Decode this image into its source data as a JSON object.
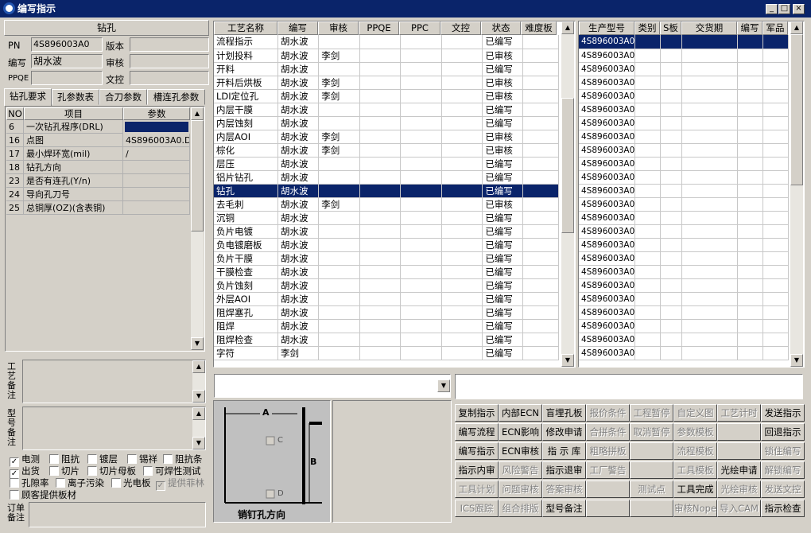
{
  "window": {
    "title": "编写指示",
    "min": "_",
    "max": "□",
    "close": "×"
  },
  "top": {
    "name": "钻孔",
    "pn_label": "PN",
    "pn_value": "4S896003A0",
    "version_label": "版本",
    "version_value": "",
    "author_label": "编写",
    "author_value": "胡水波",
    "review_label": "审核",
    "review_value": "",
    "ppqe_label": "PPQE",
    "ppqe_value": "",
    "control_label": "文控",
    "control_value": ""
  },
  "tabs": [
    "钻孔要求",
    "孔参数表",
    "合刀参数",
    "槽连孔参数"
  ],
  "param_table": {
    "headers": [
      "NO",
      "项目",
      "参数"
    ],
    "rows": [
      [
        "6",
        "一次钻孔程序(DRL)",
        ""
      ],
      [
        "16",
        "点图",
        "4S896003A0.D"
      ],
      [
        "17",
        "最小焊环宽(mil)",
        "/"
      ],
      [
        "18",
        "钻孔方向",
        ""
      ],
      [
        "23",
        "是否有连孔(Y/n)",
        ""
      ],
      [
        "24",
        "导向孔刀号",
        ""
      ],
      [
        "25",
        "总铜厚(OZ)(含表铜)",
        ""
      ]
    ]
  },
  "notes": {
    "process_note": "工艺备注",
    "model_note": "型号备注",
    "order_note": "订单备注"
  },
  "checkboxes": [
    {
      "label": "电测",
      "checked": true,
      "disabled": false
    },
    {
      "label": "阻抗",
      "checked": false,
      "disabled": false
    },
    {
      "label": "镀层",
      "checked": false,
      "disabled": false
    },
    {
      "label": "锡祥",
      "checked": false,
      "disabled": false
    },
    {
      "label": "阻抗条",
      "checked": false,
      "disabled": false
    },
    {
      "label": "出货",
      "checked": true,
      "disabled": false
    },
    {
      "label": "切片",
      "checked": false,
      "disabled": false
    },
    {
      "label": "切片母板",
      "checked": false,
      "disabled": false
    },
    {
      "label": "可焊性测试",
      "checked": false,
      "disabled": false
    },
    {
      "label": "孔隙率",
      "checked": false,
      "disabled": false
    },
    {
      "label": "离子污染",
      "checked": false,
      "disabled": false
    },
    {
      "label": "光电板",
      "checked": false,
      "disabled": false
    },
    {
      "label": "提供菲林",
      "checked": true,
      "disabled": true
    },
    {
      "label": "顾客提供板材",
      "checked": false,
      "disabled": false
    }
  ],
  "process_table": {
    "headers": [
      "工艺名称",
      "编写",
      "审核",
      "PPQE",
      "PPC",
      "文控",
      "状态",
      "难度板"
    ],
    "rows": [
      [
        "流程指示",
        "胡水波",
        "",
        "",
        "",
        "",
        "已编写",
        ""
      ],
      [
        "计划投料",
        "胡水波",
        "李剑",
        "",
        "",
        "",
        "已审核",
        ""
      ],
      [
        "开料",
        "胡水波",
        "",
        "",
        "",
        "",
        "已编写",
        ""
      ],
      [
        "开料后烘板",
        "胡水波",
        "李剑",
        "",
        "",
        "",
        "已审核",
        ""
      ],
      [
        "LDI定位孔",
        "胡水波",
        "李剑",
        "",
        "",
        "",
        "已审核",
        ""
      ],
      [
        "内层干膜",
        "胡水波",
        "",
        "",
        "",
        "",
        "已编写",
        ""
      ],
      [
        "内层蚀刻",
        "胡水波",
        "",
        "",
        "",
        "",
        "已编写",
        ""
      ],
      [
        "内层AOI",
        "胡水波",
        "李剑",
        "",
        "",
        "",
        "已审核",
        ""
      ],
      [
        "棕化",
        "胡水波",
        "李剑",
        "",
        "",
        "",
        "已审核",
        ""
      ],
      [
        "层压",
        "胡水波",
        "",
        "",
        "",
        "",
        "已编写",
        ""
      ],
      [
        "铝片钻孔",
        "胡水波",
        "",
        "",
        "",
        "",
        "已编写",
        ""
      ],
      [
        "钻孔",
        "胡水波",
        "",
        "",
        "",
        "",
        "已编写",
        ""
      ],
      [
        "去毛刺",
        "胡水波",
        "李剑",
        "",
        "",
        "",
        "已审核",
        ""
      ],
      [
        "沉铜",
        "胡水波",
        "",
        "",
        "",
        "",
        "已编写",
        ""
      ],
      [
        "负片电镀",
        "胡水波",
        "",
        "",
        "",
        "",
        "已编写",
        ""
      ],
      [
        "负电镀磨板",
        "胡水波",
        "",
        "",
        "",
        "",
        "已编写",
        ""
      ],
      [
        "负片干膜",
        "胡水波",
        "",
        "",
        "",
        "",
        "已编写",
        ""
      ],
      [
        "干膜检查",
        "胡水波",
        "",
        "",
        "",
        "",
        "已编写",
        ""
      ],
      [
        "负片蚀刻",
        "胡水波",
        "",
        "",
        "",
        "",
        "已编写",
        ""
      ],
      [
        "外层AOI",
        "胡水波",
        "",
        "",
        "",
        "",
        "已编写",
        ""
      ],
      [
        "阻焊塞孔",
        "胡水波",
        "",
        "",
        "",
        "",
        "已编写",
        ""
      ],
      [
        "阻焊",
        "胡水波",
        "",
        "",
        "",
        "",
        "已编写",
        ""
      ],
      [
        "阻焊检查",
        "胡水波",
        "",
        "",
        "",
        "",
        "已编写",
        ""
      ],
      [
        "字符",
        "李剑",
        "",
        "",
        "",
        "",
        "已编写",
        ""
      ]
    ],
    "selected": 11
  },
  "model_table": {
    "headers": [
      "生产型号",
      "类别",
      "S板",
      "交货期",
      "编写",
      "军品"
    ],
    "value": "4S896003A0",
    "count": 24
  },
  "diagram": {
    "label_a": "A",
    "label_b": "B",
    "label_c": "C",
    "label_d": "D",
    "caption": "销钉孔方向"
  },
  "buttons": [
    [
      {
        "t": "复制指示",
        "d": false
      },
      {
        "t": "内部ECN",
        "d": false
      },
      {
        "t": "盲埋孔板",
        "d": false
      },
      {
        "t": "报价条件",
        "d": true
      },
      {
        "t": "工程暂停",
        "d": true
      },
      {
        "t": "自定义图",
        "d": true
      },
      {
        "t": "工艺计时",
        "d": true
      },
      {
        "t": "发送指示",
        "d": false
      }
    ],
    [
      {
        "t": "编写流程",
        "d": false
      },
      {
        "t": "ECN影响",
        "d": false
      },
      {
        "t": "修改申请",
        "d": false
      },
      {
        "t": "合拼条件",
        "d": true
      },
      {
        "t": "取消暂停",
        "d": true
      },
      {
        "t": "参数模板",
        "d": true
      },
      {
        "t": "",
        "d": true
      },
      {
        "t": "回退指示",
        "d": false
      }
    ],
    [
      {
        "t": "编写指示",
        "d": false
      },
      {
        "t": "ECN审核",
        "d": false
      },
      {
        "t": "指 示 库",
        "d": false
      },
      {
        "t": "粗略拼板",
        "d": true
      },
      {
        "t": "",
        "d": true
      },
      {
        "t": "流程模板",
        "d": true
      },
      {
        "t": "",
        "d": true
      },
      {
        "t": "锁住编写",
        "d": true
      }
    ],
    [
      {
        "t": "指示内审",
        "d": false
      },
      {
        "t": "风险警告",
        "d": true
      },
      {
        "t": "指示退审",
        "d": false
      },
      {
        "t": "工厂警告",
        "d": true
      },
      {
        "t": "",
        "d": true
      },
      {
        "t": "工具模板",
        "d": true
      },
      {
        "t": "光绘申请",
        "d": false
      },
      {
        "t": "解锁编写",
        "d": true
      }
    ],
    [
      {
        "t": "工具计划",
        "d": true
      },
      {
        "t": "问题审核",
        "d": true
      },
      {
        "t": "答案审核",
        "d": true
      },
      {
        "t": "",
        "d": true
      },
      {
        "t": "测试点",
        "d": true
      },
      {
        "t": "工具完成",
        "d": false
      },
      {
        "t": "光绘审核",
        "d": true
      },
      {
        "t": "发送文控",
        "d": true
      }
    ],
    [
      {
        "t": "ICS跟踪",
        "d": true
      },
      {
        "t": "组合排版",
        "d": true
      },
      {
        "t": "型号备注",
        "d": false
      },
      {
        "t": "",
        "d": true
      },
      {
        "t": "",
        "d": true
      },
      {
        "t": "审核Nope",
        "d": true
      },
      {
        "t": "导入CAM",
        "d": true
      },
      {
        "t": "指示检查",
        "d": false
      }
    ]
  ]
}
